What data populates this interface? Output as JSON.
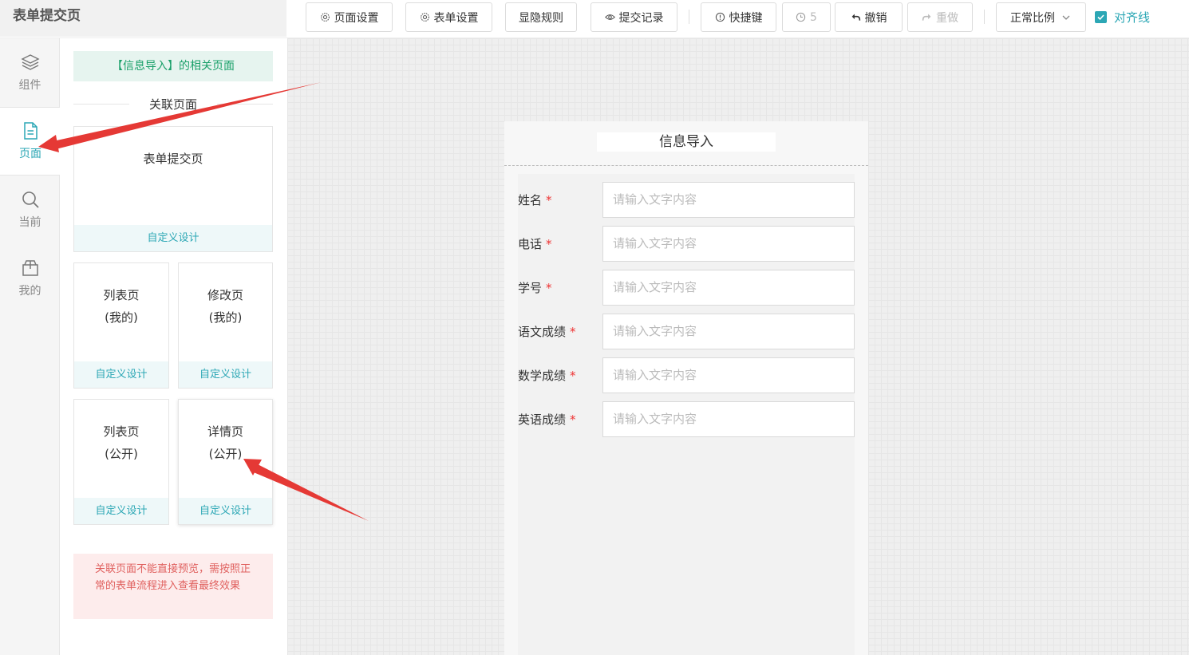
{
  "header": {
    "app_title": "表单提交页",
    "toolbar": {
      "page_settings": "页面设置",
      "form_settings": "表单设置",
      "visibility_rules": "显隐规则",
      "submit_records": "提交记录",
      "shortcuts": "快捷键",
      "history_count": "5",
      "undo": "撤销",
      "redo": "重做",
      "zoom": "正常比例",
      "align_lines": "对齐线"
    }
  },
  "rail": {
    "items": [
      {
        "label": "组件",
        "icon": "layers-icon"
      },
      {
        "label": "页面",
        "icon": "document-icon",
        "active": true
      },
      {
        "label": "当前",
        "icon": "search-icon"
      },
      {
        "label": "我的",
        "icon": "box-icon"
      }
    ]
  },
  "panel": {
    "banner": "【信息导入】的相关页面",
    "section_title": "关联页面",
    "cards": [
      {
        "title": "表单提交页",
        "footer": "自定义设计"
      },
      {
        "title": "列表页\n(我的)",
        "footer": "自定义设计"
      },
      {
        "title": "修改页\n(我的)",
        "footer": "自定义设计"
      },
      {
        "title": "列表页\n(公开)",
        "footer": "自定义设计"
      },
      {
        "title": "详情页\n(公开)",
        "footer": "自定义设计"
      }
    ],
    "notice": "关联页面不能直接预览，需按照正常的表单流程进入查看最终效果"
  },
  "canvas": {
    "page_title": "信息导入",
    "fields": [
      {
        "label": "姓名",
        "required": "*",
        "placeholder": "请输入文字内容"
      },
      {
        "label": "电话",
        "required": "*",
        "placeholder": "请输入文字内容"
      },
      {
        "label": "学号",
        "required": "*",
        "placeholder": "请输入文字内容"
      },
      {
        "label": "语文成绩",
        "required": "*",
        "placeholder": "请输入文字内容"
      },
      {
        "label": "数学成绩",
        "required": "*",
        "placeholder": "请输入文字内容"
      },
      {
        "label": "英语成绩",
        "required": "*",
        "placeholder": "请输入文字内容"
      }
    ]
  },
  "colors": {
    "accent": "#2ca7b5",
    "banner_green": "#1aa06a",
    "notice_red": "#e0615f",
    "arrow_red": "#e53935"
  }
}
